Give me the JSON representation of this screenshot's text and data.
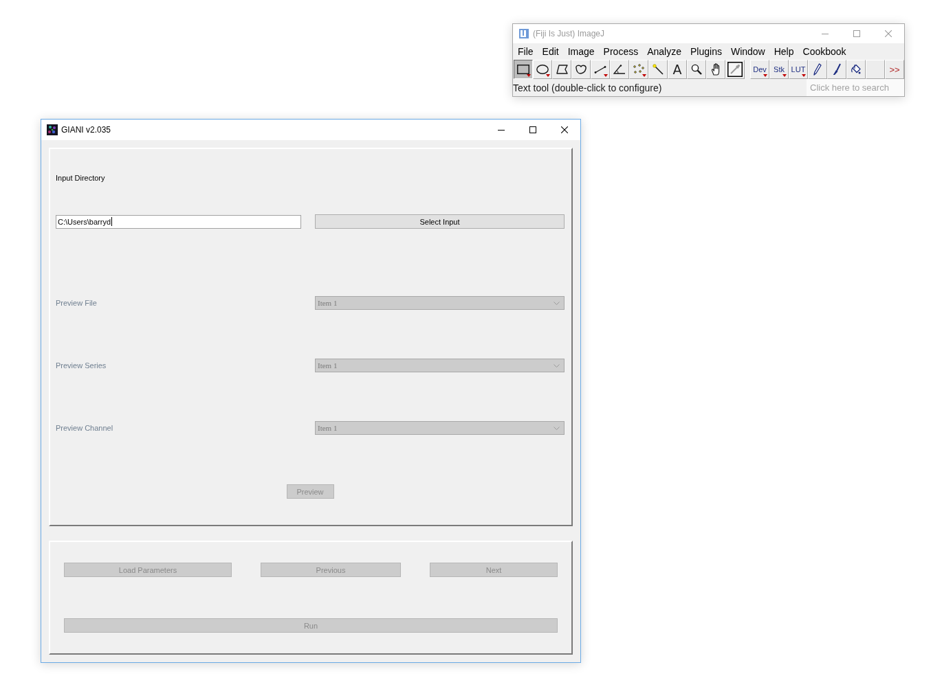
{
  "imagej": {
    "title": "(Fiji Is Just) ImageJ",
    "active": false,
    "menus": [
      "File",
      "Edit",
      "Image",
      "Process",
      "Analyze",
      "Plugins",
      "Window",
      "Help",
      "Cookbook"
    ],
    "tools": [
      {
        "kind": "icon",
        "selected": true,
        "menu": true
      },
      {
        "kind": "icon",
        "selected": false,
        "menu": true
      },
      {
        "kind": "icon",
        "selected": false,
        "menu": false
      },
      {
        "kind": "icon",
        "selected": false,
        "menu": false
      },
      {
        "kind": "icon",
        "selected": false,
        "menu": true
      },
      {
        "kind": "icon",
        "selected": false,
        "menu": false
      },
      {
        "kind": "icon",
        "selected": false,
        "menu": true
      },
      {
        "kind": "icon",
        "selected": false,
        "menu": false
      },
      {
        "kind": "glyph",
        "label": "A",
        "selected": false,
        "menu": false
      },
      {
        "kind": "icon",
        "selected": false,
        "menu": false
      },
      {
        "kind": "icon",
        "selected": false,
        "menu": false
      },
      {
        "kind": "icon",
        "selected": false,
        "menu": false
      }
    ],
    "extra_tools": [
      {
        "kind": "text",
        "label": "Dev",
        "selected": false,
        "menu": true
      },
      {
        "kind": "text",
        "label": "Stk",
        "selected": false,
        "menu": true
      },
      {
        "kind": "text",
        "label": "LUT",
        "selected": false,
        "menu": true
      },
      {
        "kind": "icon",
        "selected": false,
        "menu": false
      },
      {
        "kind": "icon",
        "selected": false,
        "menu": false
      },
      {
        "kind": "icon",
        "selected": false,
        "menu": false
      },
      {
        "kind": "blank",
        "selected": false,
        "menu": false
      },
      {
        "kind": "more",
        "label": ">>",
        "selected": false,
        "menu": false
      }
    ],
    "status": "Text tool (double-click to configure)",
    "search": {
      "placeholder": "Click here to search"
    }
  },
  "giani": {
    "title": "GIANI v2.035",
    "active": true,
    "input_label": "Input Directory",
    "input": {
      "value": "C:\\Users\\barryd",
      "focused": true
    },
    "select_button": {
      "label": "Select Input",
      "disabled": false
    },
    "previews": [
      {
        "label": "Preview File",
        "value": "Item 1",
        "disabled": true
      },
      {
        "label": "Preview Series",
        "value": "Item 1",
        "disabled": true
      },
      {
        "label": "Preview Channel",
        "value": "Item 1",
        "disabled": true
      }
    ],
    "preview_button": {
      "label": "Preview",
      "disabled": true
    },
    "nav_buttons": [
      {
        "label": "Load Parameters",
        "disabled": true
      },
      {
        "label": "Previous",
        "disabled": true
      },
      {
        "label": "Next",
        "disabled": true
      }
    ],
    "run_button": {
      "label": "Run",
      "disabled": true
    }
  }
}
